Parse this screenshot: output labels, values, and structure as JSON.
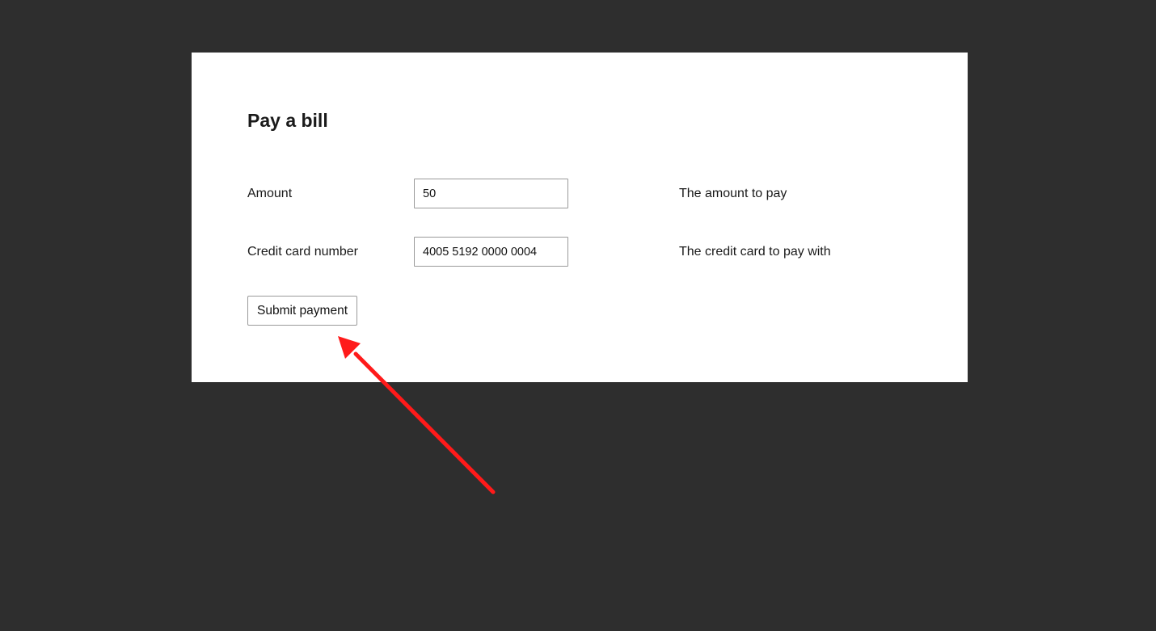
{
  "form": {
    "title": "Pay a bill",
    "fields": [
      {
        "label": "Amount",
        "value": "50",
        "hint": "The amount to pay"
      },
      {
        "label": "Credit card number",
        "value": "4005 5192 0000 0004",
        "hint": "The credit card to pay with"
      }
    ],
    "submit_label": "Submit payment"
  },
  "colors": {
    "background": "#2e2e2e",
    "card": "#ffffff",
    "annotation_arrow": "#ff1a1a"
  },
  "annotation": {
    "icon": "arrow-icon"
  }
}
